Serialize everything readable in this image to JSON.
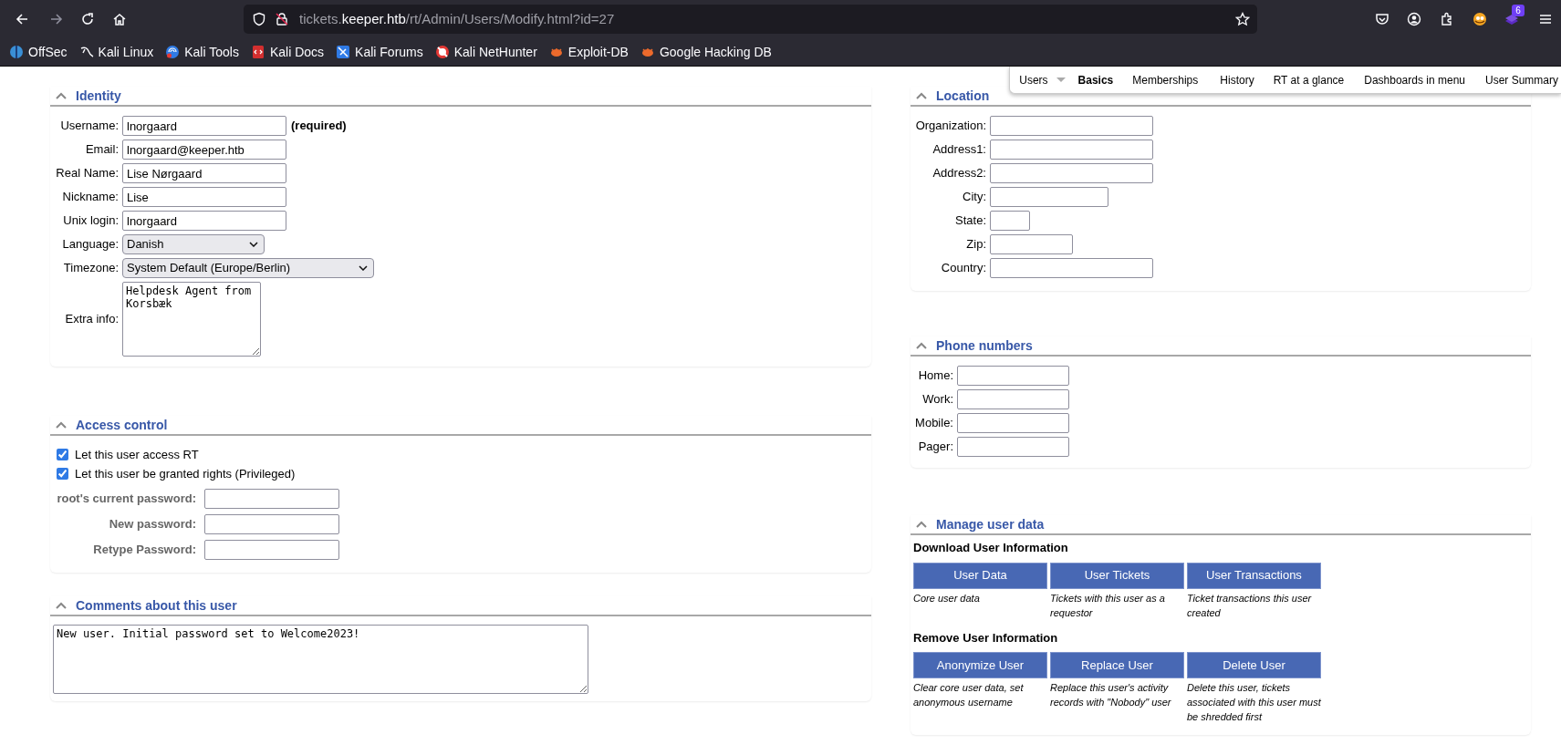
{
  "toolbar": {
    "forward_enabled": false,
    "url": {
      "subdomain": "tickets.",
      "domain": "keeper.htb",
      "path": "/rt/Admin/Users/Modify.html?id=27"
    },
    "extension_badge": "6"
  },
  "bookmarks": [
    "OffSec",
    "Kali Linux",
    "Kali Tools",
    "Kali Docs",
    "Kali Forums",
    "Kali NetHunter",
    "Exploit-DB",
    "Google Hacking DB"
  ],
  "page_menu": [
    {
      "label": "Users",
      "dropdown": true,
      "selected": false
    },
    {
      "label": "Basics",
      "dropdown": false,
      "selected": true
    },
    {
      "label": "Memberships",
      "dropdown": false,
      "selected": false
    },
    {
      "label": "History",
      "dropdown": false,
      "selected": false
    },
    {
      "label": "RT at a glance",
      "dropdown": false,
      "selected": false
    },
    {
      "label": "Dashboards in menu",
      "dropdown": false,
      "selected": false
    },
    {
      "label": "User Summary",
      "dropdown": false,
      "selected": false
    }
  ],
  "left_column": [
    {
      "title": "Identity",
      "expanded": true,
      "kind": "form",
      "fields": [
        {
          "kind": "text",
          "label": "Username:",
          "value": "lnorgaard",
          "note": "(required)"
        },
        {
          "kind": "text",
          "label": "Email:",
          "value": "lnorgaard@keeper.htb"
        },
        {
          "kind": "text",
          "label": "Real Name:",
          "value": "Lise Nørgaard"
        },
        {
          "kind": "text",
          "label": "Nickname:",
          "value": "Lise"
        },
        {
          "kind": "text",
          "label": "Unix login:",
          "value": "lnorgaard"
        },
        {
          "kind": "select",
          "label": "Language:",
          "value": "Danish"
        },
        {
          "kind": "select",
          "label": "Timezone:",
          "value": "System Default (Europe/Berlin)"
        },
        {
          "kind": "textarea",
          "label": "Extra info:",
          "value": "Helpdesk Agent from Korsbæk"
        }
      ]
    },
    {
      "title": "Access control",
      "expanded": true,
      "kind": "form",
      "fields": [
        {
          "kind": "checkbox",
          "label": "Let this user access RT",
          "checked": true
        },
        {
          "kind": "checkbox",
          "label": "Let this user be granted rights (Privileged)",
          "checked": true
        },
        {
          "kind": "password",
          "label": "root's current password:"
        },
        {
          "kind": "password",
          "label": "New password:"
        },
        {
          "kind": "password",
          "label": "Retype Password:"
        }
      ]
    },
    {
      "title": "Comments about this user",
      "expanded": true,
      "kind": "form",
      "fields": [
        {
          "kind": "textarea",
          "value": "New user. Initial password set to Welcome2023!"
        }
      ]
    }
  ],
  "right_column": [
    {
      "title": "Location",
      "expanded": true,
      "kind": "form",
      "fields": [
        {
          "kind": "text",
          "label": "Organization:"
        },
        {
          "kind": "text",
          "label": "Address1:"
        },
        {
          "kind": "text",
          "label": "Address2:"
        },
        {
          "kind": "text",
          "label": "City:"
        },
        {
          "kind": "text",
          "label": "State:"
        },
        {
          "kind": "text",
          "label": "Zip:"
        },
        {
          "kind": "text",
          "label": "Country:"
        }
      ]
    },
    {
      "title": "Phone numbers",
      "expanded": true,
      "kind": "form",
      "fields": [
        {
          "kind": "text",
          "label": "Home:"
        },
        {
          "kind": "text",
          "label": "Work:"
        },
        {
          "kind": "text",
          "label": "Mobile:"
        },
        {
          "kind": "text",
          "label": "Pager:"
        }
      ]
    },
    {
      "title": "Manage user data",
      "expanded": true,
      "kind": "actions",
      "groups": [
        {
          "title": "Download User Information",
          "actions": [
            {
              "label": "User Data",
              "caption": "Core user data"
            },
            {
              "label": "User Tickets",
              "caption": "Tickets with this user as a requestor"
            },
            {
              "label": "User Transactions",
              "caption": "Ticket transactions this user created"
            }
          ]
        },
        {
          "title": "Remove User Information",
          "actions": [
            {
              "label": "Anonymize User",
              "caption": "Clear core user data, set anonymous username"
            },
            {
              "label": "Replace User",
              "caption": "Replace this user's activity records with \"Nobody\" user"
            },
            {
              "label": "Delete User",
              "caption": "Delete this user, tickets associated with this user must be shredded first"
            }
          ]
        }
      ]
    }
  ]
}
